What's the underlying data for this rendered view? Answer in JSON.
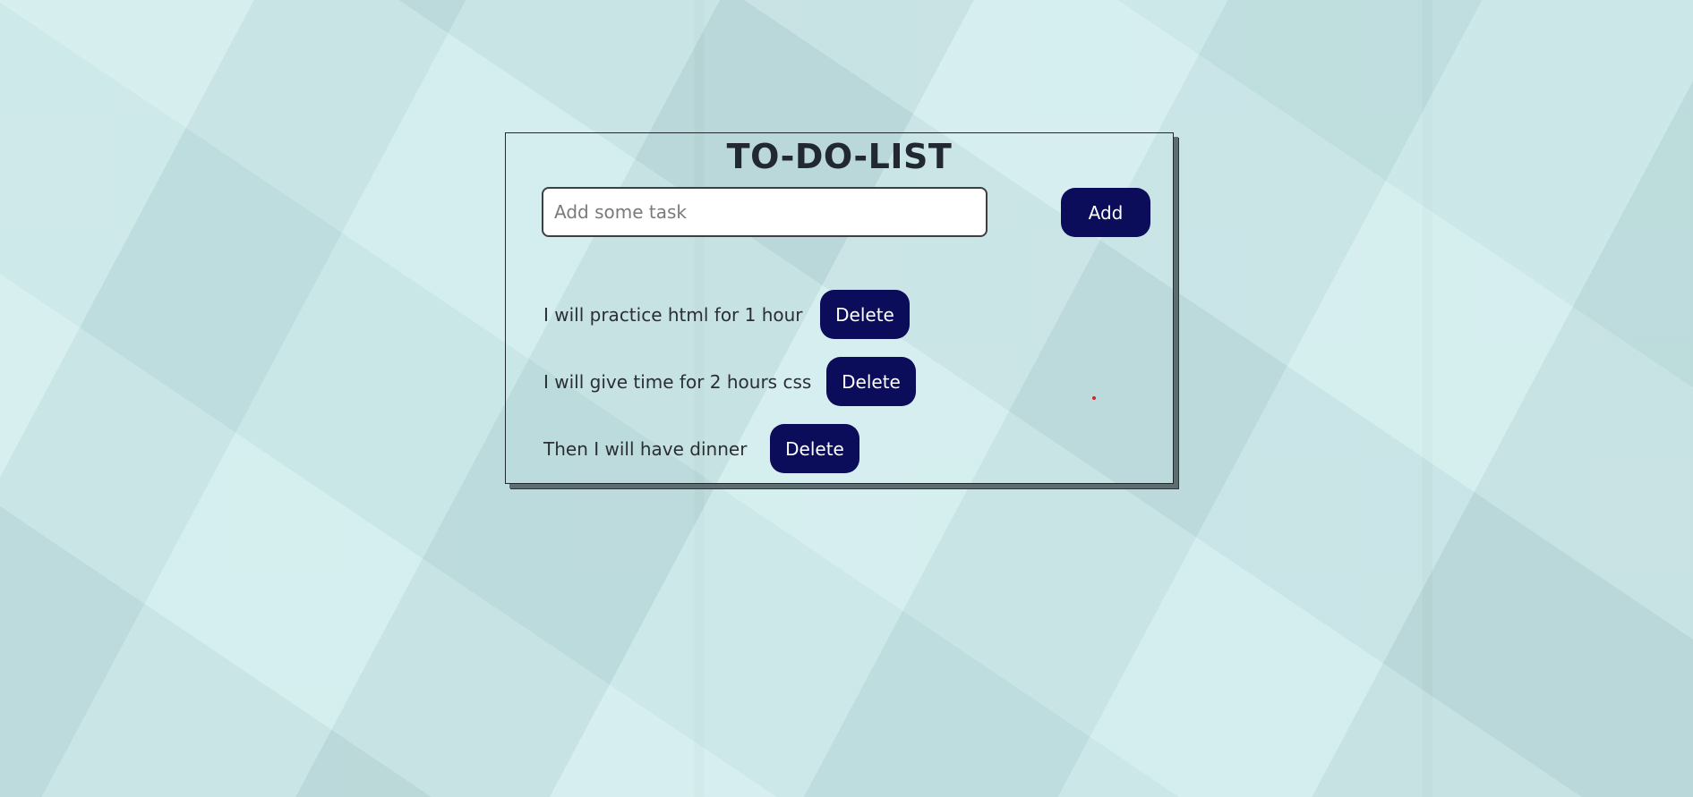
{
  "app": {
    "title": "TO-DO-LIST"
  },
  "input": {
    "placeholder": "Add some task",
    "value": ""
  },
  "buttons": {
    "add_label": "Add"
  },
  "tasks": [
    {
      "text": "I will practice html for 1 hour",
      "delete_label": "Delete"
    },
    {
      "text": "I will give time for 2 hours css",
      "delete_label": "Delete"
    },
    {
      "text": "Then I will have dinner",
      "delete_label": "Delete"
    }
  ],
  "colors": {
    "background": "#c9e9ea",
    "button": "#0b0c5a",
    "button_text": "#ffffff",
    "title": "#212831"
  }
}
